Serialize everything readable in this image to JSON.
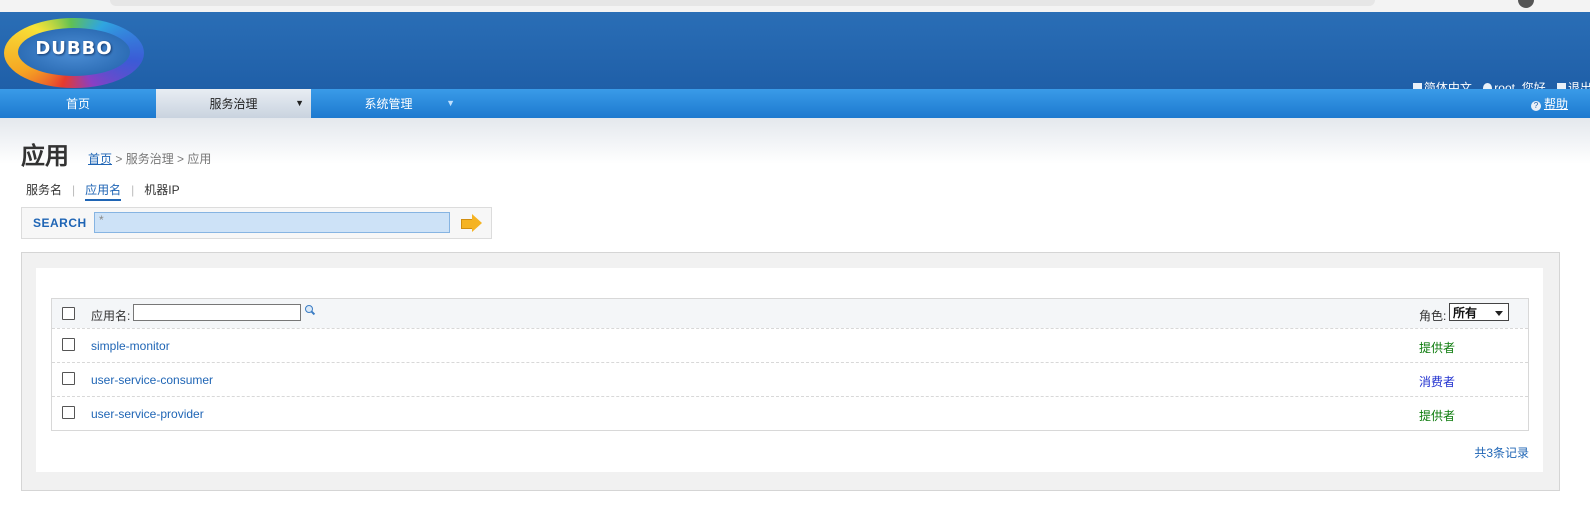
{
  "header": {
    "logo_text": "DUBBO",
    "lang_label": "简体中文",
    "user_greeting": "root, 您好",
    "logout_label": "退出"
  },
  "nav": {
    "tabs": [
      {
        "label": "首页"
      },
      {
        "label": "服务治理"
      },
      {
        "label": "系统管理"
      }
    ],
    "help_label": "帮助"
  },
  "page": {
    "title": "应用",
    "breadcrumb": {
      "home": "首页",
      "rest": " > 服务治理 > 应用"
    }
  },
  "subtabs": [
    "服务名",
    "应用名",
    "机器IP"
  ],
  "search": {
    "label": "SEARCH",
    "value": "*"
  },
  "table": {
    "app_label": "应用名:",
    "role_label": "角色:",
    "role_selected": "所有",
    "rows": [
      {
        "name": "simple-monitor",
        "role": "提供者"
      },
      {
        "name": "user-service-consumer",
        "role": "消费者"
      },
      {
        "name": "user-service-provider",
        "role": "提供者"
      }
    ],
    "total": "共3条记录"
  },
  "colors": {
    "header_blue": "#1f5fa8",
    "nav_blue": "#1d79cf",
    "link_blue": "#1f65b5",
    "provider_green": "#0a7a0a",
    "consumer_blue": "#1f2fcf"
  }
}
